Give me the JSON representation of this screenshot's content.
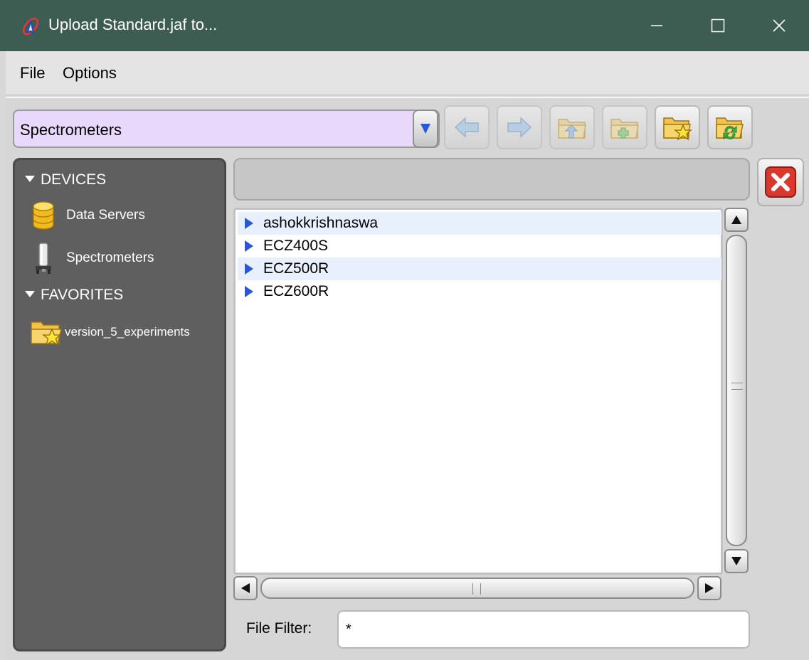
{
  "window": {
    "title": "Upload Standard.jaf to...",
    "app_icon": "jeol-delta-icon"
  },
  "menu": {
    "items": [
      {
        "label": "File"
      },
      {
        "label": "Options"
      }
    ]
  },
  "location": {
    "current": "Spectrometers"
  },
  "toolbar": {
    "buttons": [
      {
        "name": "back",
        "icon": "arrow-left-icon",
        "enabled": false
      },
      {
        "name": "forward",
        "icon": "arrow-right-icon",
        "enabled": false
      },
      {
        "name": "parent-folder",
        "icon": "folder-up-icon",
        "enabled": false
      },
      {
        "name": "new-folder",
        "icon": "folder-add-icon",
        "enabled": false
      },
      {
        "name": "add-favorite",
        "icon": "folder-star-icon",
        "enabled": true
      },
      {
        "name": "refresh",
        "icon": "folder-refresh-icon",
        "enabled": true
      }
    ]
  },
  "sidebar": {
    "sections": [
      {
        "label": "DEVICES",
        "items": [
          {
            "label": "Data Servers",
            "icon": "database-icon"
          },
          {
            "label": "Spectrometers",
            "icon": "magnet-icon"
          }
        ]
      },
      {
        "label": "FAVORITES",
        "items": [
          {
            "label": "version_5_experiments",
            "icon": "folder-star-icon"
          }
        ]
      }
    ]
  },
  "files": {
    "rows": [
      {
        "label": "ashokkrishnaswa"
      },
      {
        "label": "ECZ400S"
      },
      {
        "label": "ECZ500R"
      },
      {
        "label": "ECZ600R"
      }
    ]
  },
  "filter": {
    "label": "File Filter:",
    "value": "*"
  },
  "colors": {
    "titlebar": "#3d5c52",
    "sidebar": "#5f5f5f",
    "combo": "#e8d8fb",
    "row_alt": "#e9f0fd",
    "accent": "#2b57d7",
    "close": "#d9382e"
  }
}
